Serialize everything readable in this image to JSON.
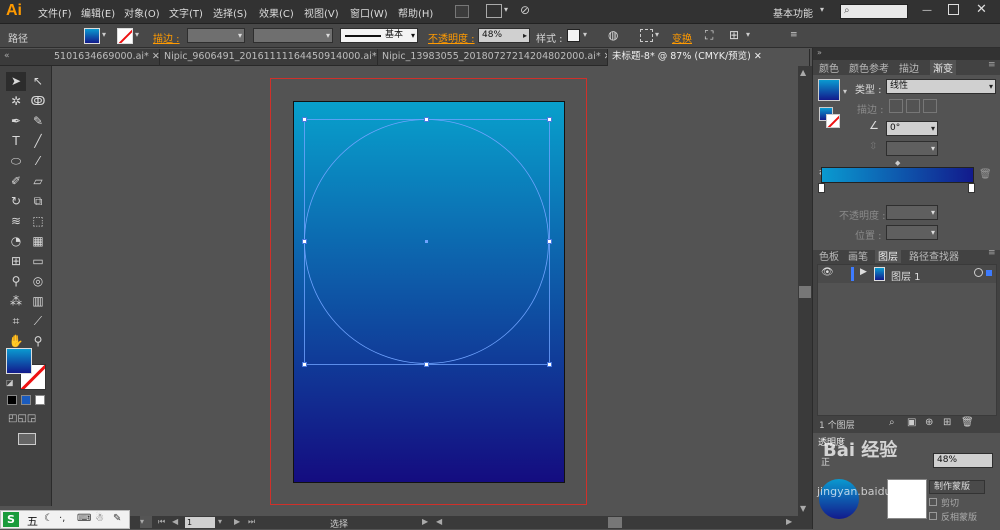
{
  "app": {
    "logo": "Ai"
  },
  "menu": [
    "文件(F)",
    "编辑(E)",
    "对象(O)",
    "文字(T)",
    "选择(S)",
    "效果(C)",
    "视图(V)",
    "窗口(W)",
    "帮助(H)"
  ],
  "workspace": {
    "label": "基本功能"
  },
  "search": {
    "placeholder": ""
  },
  "control": {
    "object_type": "路径",
    "stroke_label": "描边 :",
    "stroke_style": "基本",
    "opacity_label": "不透明度 :",
    "opacity_value": "48%",
    "style_label": "样式 :",
    "transform_label": "变换"
  },
  "doc_tabs": [
    "5101634669000.ai*",
    "Nipic_9606491_20161111164450914000.ai*",
    "Nipic_13983055_20180727214204802000.ai*",
    "未标题-8* @ 87% (CMYK/预览)"
  ],
  "panel_tabs_top": [
    "颜色",
    "颜色参考",
    "描边",
    "渐变"
  ],
  "gradient": {
    "type_label": "类型 :",
    "type_value": "线性",
    "stroke_label": "描边 :",
    "angle_value": "0°",
    "opacity_label": "不透明度 :",
    "position_label": "位置 :",
    "start_color": "#0a9ad0",
    "end_color": "#121a8c"
  },
  "panel_tabs_mid": [
    "色板",
    "画笔",
    "图层",
    "路径查找器"
  ],
  "layers": {
    "rows": [
      {
        "name": "图层 1"
      }
    ],
    "count_label": "1 个图层"
  },
  "transparency": {
    "make_mask": "制作蒙版",
    "clip": "剪切",
    "invert_mask": "反相蒙版",
    "mode_value": "正",
    "opacity_value": "48%",
    "title": "透明度"
  },
  "status": {
    "zoom": "87%",
    "page": "1",
    "tool_name": "选择"
  },
  "ime": {
    "text": "五"
  },
  "artboard": {
    "top_color": "#08a0cc",
    "bottom_color": "#140c80"
  },
  "colors": {
    "accent": "#ff9a00"
  },
  "watermark": {
    "text": "Bai 经验",
    "url": "jingyan.baidu.com"
  }
}
